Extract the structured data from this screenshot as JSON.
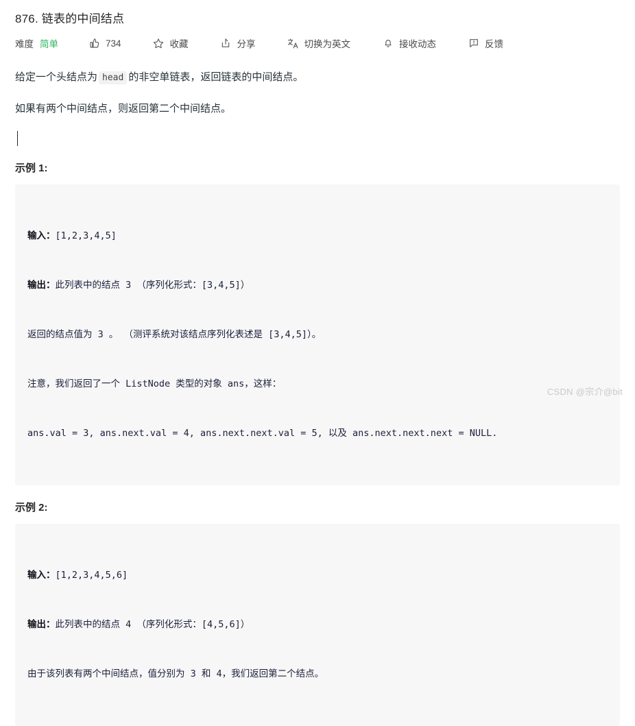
{
  "problem": {
    "title": "876. 链表的中间结点"
  },
  "meta": {
    "difficulty_label": "难度",
    "difficulty_value": "简单",
    "difficulty_color": "#2db55d",
    "vote_count": "734",
    "favorite_label": "收藏",
    "share_label": "分享",
    "translate_label": "切换为英文",
    "subscribe_label": "接收动态",
    "feedback_label": "反馈",
    "icons": {
      "vote": "thumbs-up-icon",
      "favorite": "star-icon",
      "share": "share-icon",
      "translate": "translate-icon",
      "subscribe": "bell-icon",
      "feedback": "feedback-icon"
    }
  },
  "description": {
    "paragraph_1_before": "给定一个头结点为",
    "paragraph_1_code": "head",
    "paragraph_1_after": "的非空单链表，返回链表的中间结点。",
    "paragraph_2": "如果有两个中间结点，则返回第二个中间结点。"
  },
  "examples": [
    {
      "heading": "示例 1:",
      "lines": [
        {
          "bold": "输入：",
          "rest": "[1,2,3,4,5]"
        },
        {
          "bold": "输出：",
          "rest": "此列表中的结点 3 （序列化形式：[3,4,5]）"
        },
        {
          "bold": "",
          "rest": "返回的结点值为 3 。 （测评系统对该结点序列化表述是 [3,4,5]）。"
        },
        {
          "bold": "",
          "rest": "注意，我们返回了一个 ListNode 类型的对象 ans，这样："
        },
        {
          "bold": "",
          "rest": "ans.val = 3, ans.next.val = 4, ans.next.next.val = 5, 以及 ans.next.next.next = NULL."
        }
      ]
    },
    {
      "heading": "示例 2:",
      "lines": [
        {
          "bold": "输入：",
          "rest": "[1,2,3,4,5,6]"
        },
        {
          "bold": "输出：",
          "rest": "此列表中的结点 4 （序列化形式：[4,5,6]）"
        },
        {
          "bold": "",
          "rest": "由于该列表有两个中间结点，值分别为 3 和 4，我们返回第二个结点。"
        }
      ]
    }
  ],
  "watermark": {
    "text": "CSDN @宗介@bit"
  }
}
